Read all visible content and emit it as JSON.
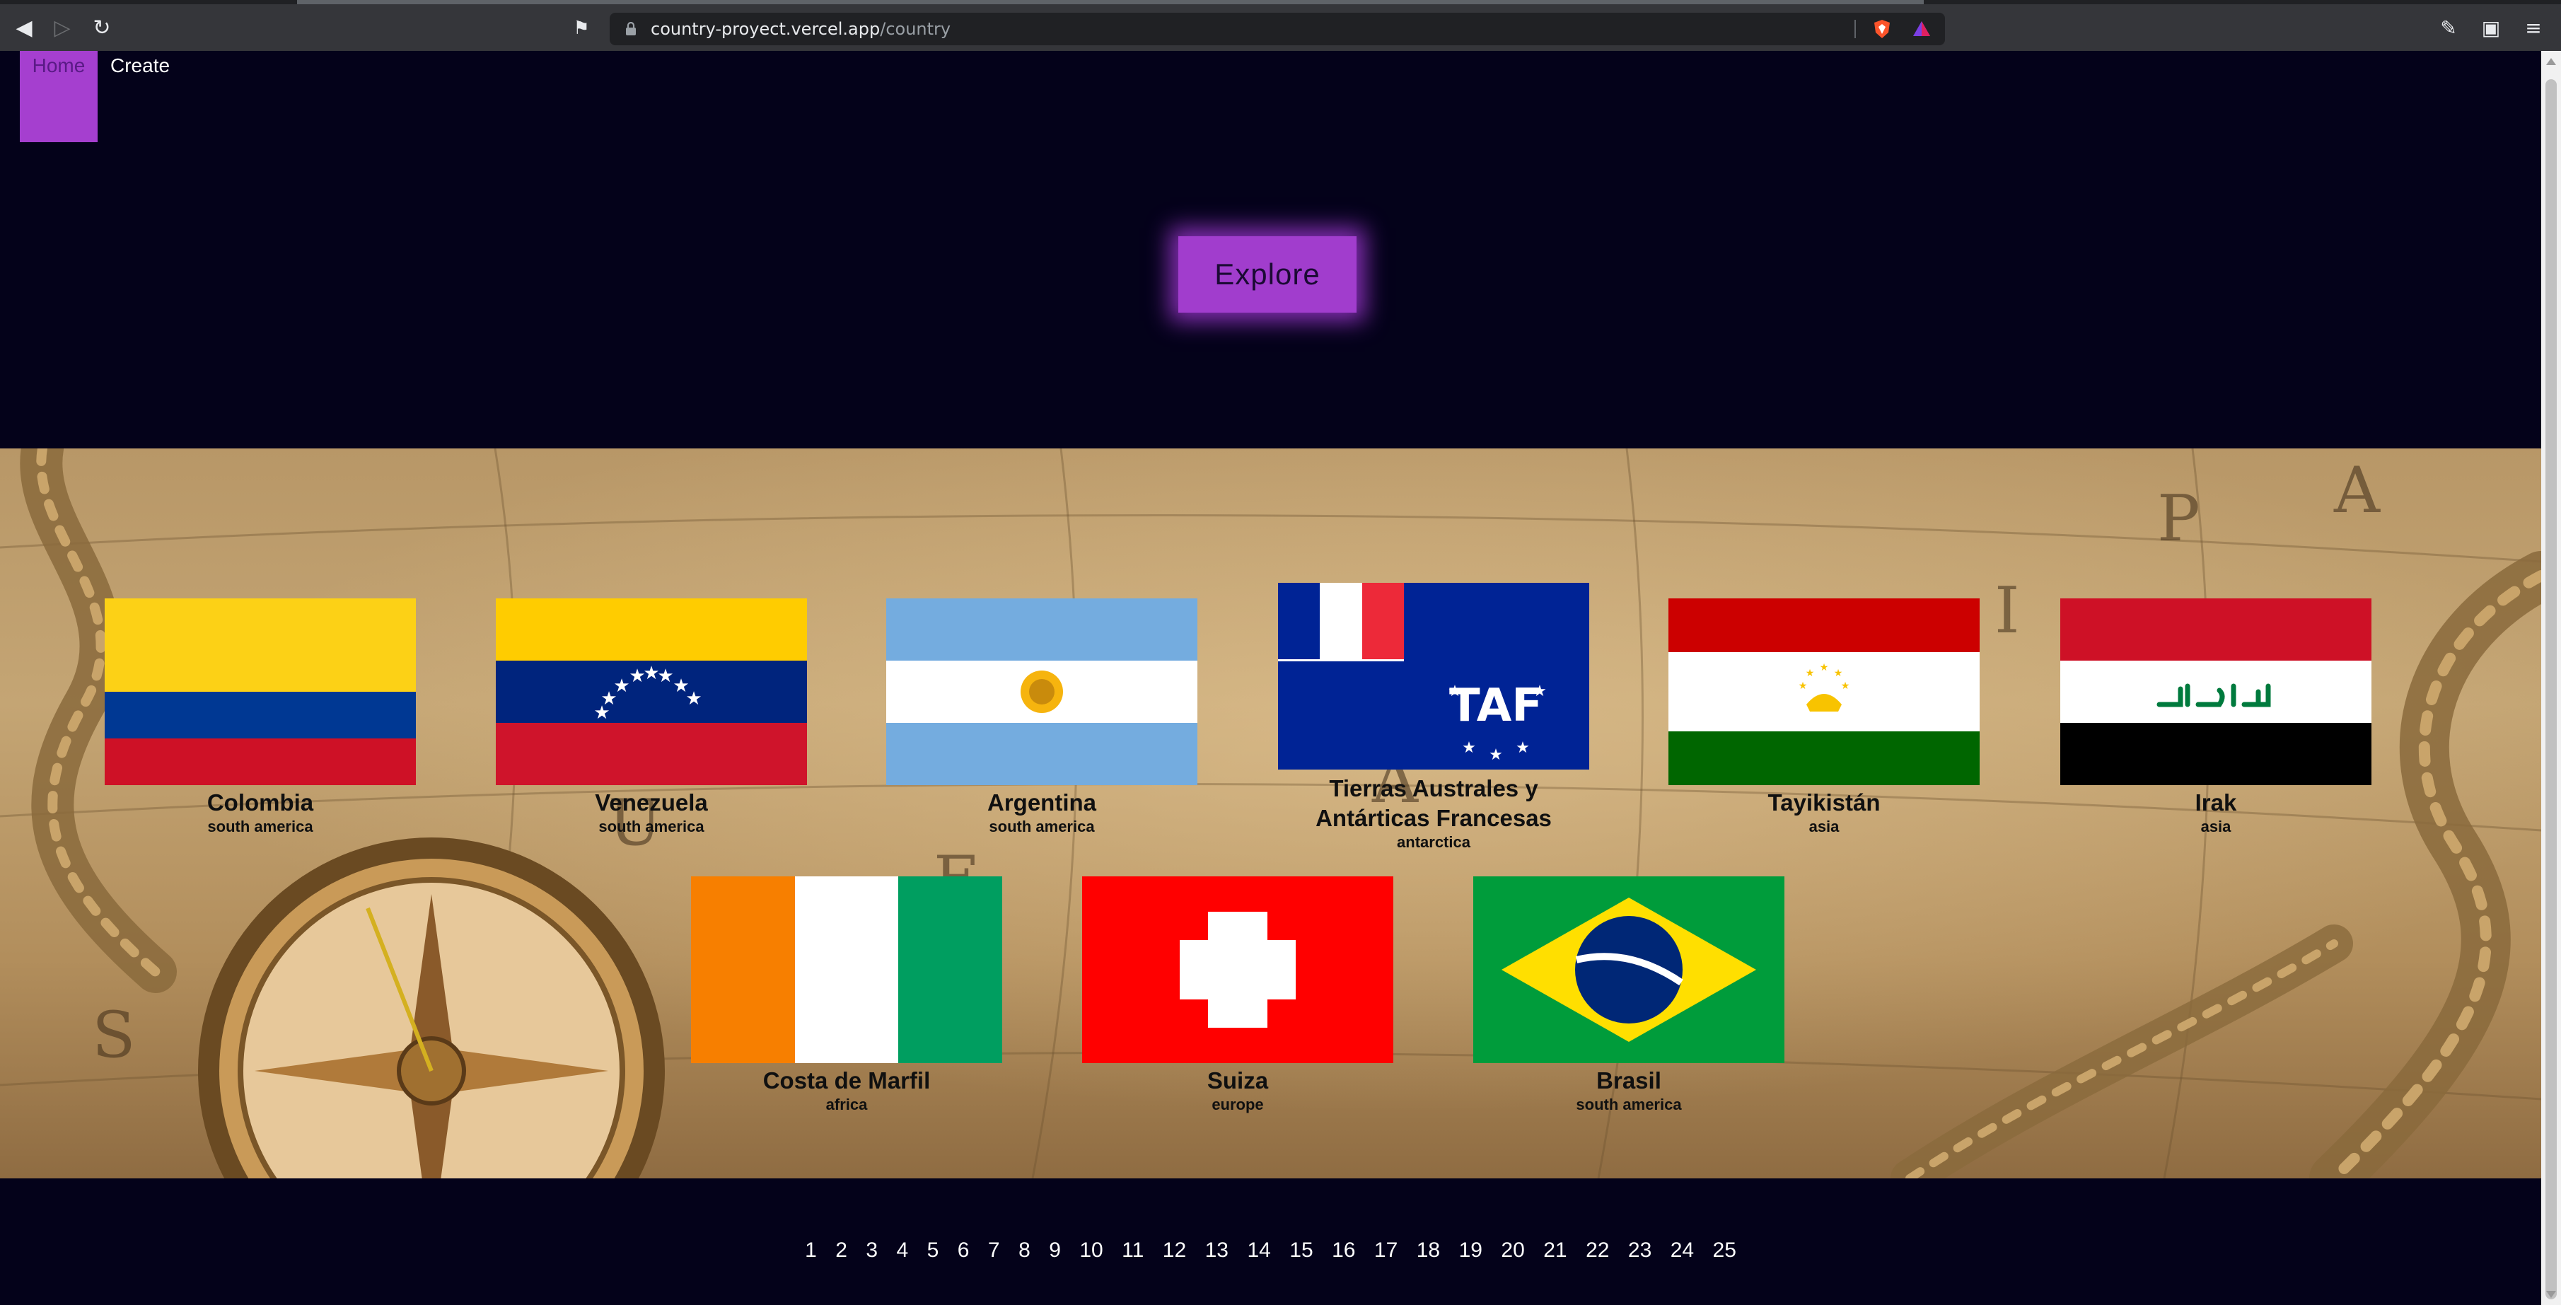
{
  "browser": {
    "url_host": "country-proyect.vercel.app",
    "url_path": "/country"
  },
  "nav": {
    "home_label": "Home",
    "create_label": "Create"
  },
  "explore_label": "Explore",
  "countries": [
    {
      "name": "Colombia",
      "continent": "south america",
      "flag": "colombia"
    },
    {
      "name": "Venezuela",
      "continent": "south america",
      "flag": "venezuela"
    },
    {
      "name": "Argentina",
      "continent": "south america",
      "flag": "argentina"
    },
    {
      "name_line1": "Tierras Australes y",
      "name_line2": "Antárticas Francesas",
      "continent": "antarctica",
      "flag": "taaf"
    },
    {
      "name": "Tayikistán",
      "continent": "asia",
      "flag": "tajikistan"
    },
    {
      "name": "Irak",
      "continent": "asia",
      "flag": "iraq"
    },
    {
      "name": "Costa de Marfil",
      "continent": "africa",
      "flag": "ivory-coast"
    },
    {
      "name": "Suiza",
      "continent": "europe",
      "flag": "switzerland"
    },
    {
      "name": "Brasil",
      "continent": "south america",
      "flag": "brazil"
    }
  ],
  "pages": [
    "1",
    "2",
    "3",
    "4",
    "5",
    "6",
    "7",
    "8",
    "9",
    "10",
    "11",
    "12",
    "13",
    "14",
    "15",
    "16",
    "17",
    "18",
    "19",
    "20",
    "21",
    "22",
    "23",
    "24",
    "25"
  ],
  "colors": {
    "accent": "#a53fcf",
    "page_bg": "#04021a"
  }
}
